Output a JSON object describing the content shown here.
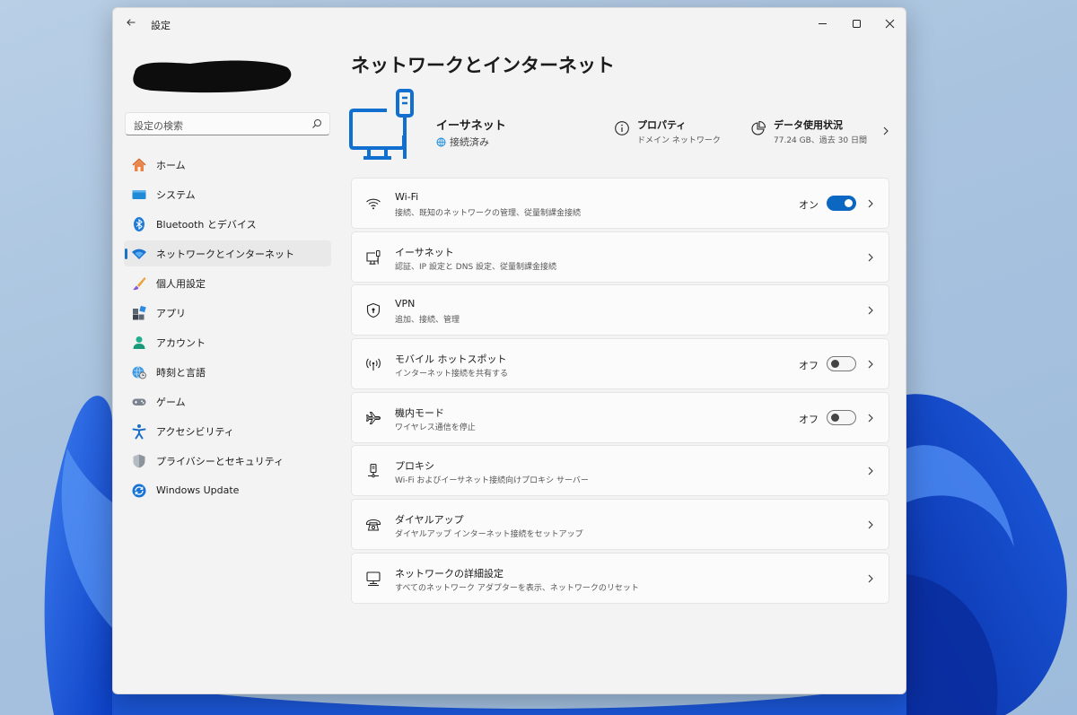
{
  "window": {
    "title": "設定",
    "back_icon": "back-arrow-icon",
    "controls": [
      "minimize-icon",
      "maximize-icon",
      "close-icon"
    ]
  },
  "search": {
    "placeholder": "設定の検索"
  },
  "sidebar": {
    "items": [
      {
        "label": "ホーム",
        "icon": "home-icon"
      },
      {
        "label": "システム",
        "icon": "system-icon"
      },
      {
        "label": "Bluetooth とデバイス",
        "icon": "bluetooth-icon"
      },
      {
        "label": "ネットワークとインターネット",
        "icon": "network-icon",
        "active": true
      },
      {
        "label": "個人用設定",
        "icon": "brush-icon"
      },
      {
        "label": "アプリ",
        "icon": "apps-icon"
      },
      {
        "label": "アカウント",
        "icon": "account-icon"
      },
      {
        "label": "時刻と言語",
        "icon": "globe-clock-icon"
      },
      {
        "label": "ゲーム",
        "icon": "gamepad-icon"
      },
      {
        "label": "アクセシビリティ",
        "icon": "accessibility-icon"
      },
      {
        "label": "プライバシーとセキュリティ",
        "icon": "shield-icon"
      },
      {
        "label": "Windows Update",
        "icon": "update-icon"
      }
    ]
  },
  "main": {
    "title": "ネットワークとインターネット",
    "hero": {
      "name": "イーサネット",
      "status": "接続済み",
      "properties_title": "プロパティ",
      "properties_sub": "ドメイン ネットワーク",
      "data_title": "データ使用状況",
      "data_sub": "77.24 GB、過去 30 日間"
    },
    "cards": [
      {
        "title": "Wi-Fi",
        "sub": "接続、既知のネットワークの管理、従量制課金接続",
        "icon": "wifi-icon",
        "toggle": "on",
        "toggle_label": "オン"
      },
      {
        "title": "イーサネット",
        "sub": "認証、IP 設定と DNS 設定、従量制課金接続",
        "icon": "ethernet-icon"
      },
      {
        "title": "VPN",
        "sub": "追加、接続、管理",
        "icon": "vpn-shield-icon"
      },
      {
        "title": "モバイル ホットスポット",
        "sub": "インターネット接続を共有する",
        "icon": "hotspot-icon",
        "toggle": "off",
        "toggle_label": "オフ"
      },
      {
        "title": "機内モード",
        "sub": "ワイヤレス通信を停止",
        "icon": "airplane-icon",
        "toggle": "off",
        "toggle_label": "オフ"
      },
      {
        "title": "プロキシ",
        "sub": "Wi-Fi およびイーサネット接続向けプロキシ サーバー",
        "icon": "proxy-icon"
      },
      {
        "title": "ダイヤルアップ",
        "sub": "ダイヤルアップ インターネット接続をセットアップ",
        "icon": "dialup-icon"
      },
      {
        "title": "ネットワークの詳細設定",
        "sub": "すべてのネットワーク アダプターを表示、ネットワークのリセット",
        "icon": "advanced-network-icon"
      }
    ]
  },
  "colors": {
    "accent": "#0c67c2",
    "window_bg": "#f3f3f3",
    "card_bg": "#fbfbfb"
  }
}
